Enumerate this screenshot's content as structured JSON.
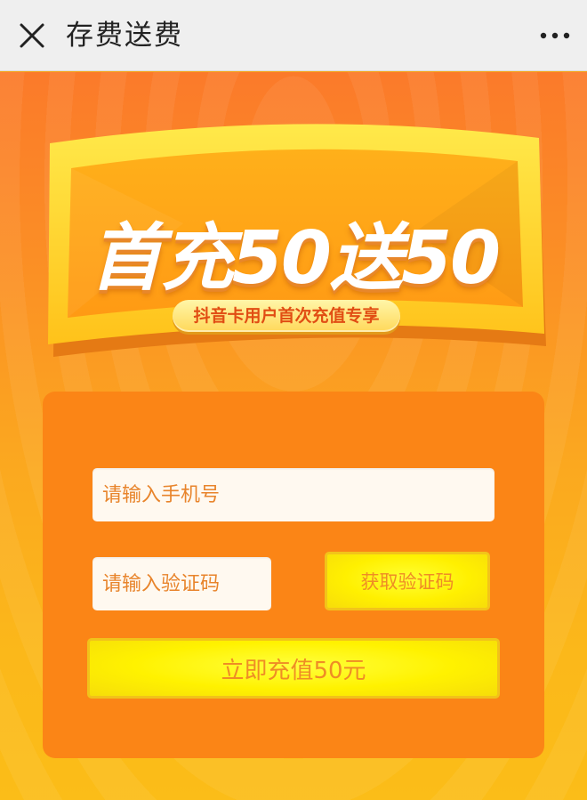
{
  "nav": {
    "title": "存费送费",
    "close_icon": "close-icon",
    "more_icon": "more-dots-icon"
  },
  "banner": {
    "headline": "首充50送50",
    "subtitle": "抖音卡用户首次充值专享"
  },
  "form": {
    "phone_placeholder": "请输入手机号",
    "code_placeholder": "请输入验证码",
    "get_code_label": "获取验证码",
    "submit_label": "立即充值50元"
  },
  "colors": {
    "top_bar": "#efefef",
    "page_top": "#fb7a2a",
    "page_bottom": "#fbbd18",
    "card": "#fb8516",
    "button_yellow": "#fff200",
    "button_text": "#ef8c25"
  }
}
